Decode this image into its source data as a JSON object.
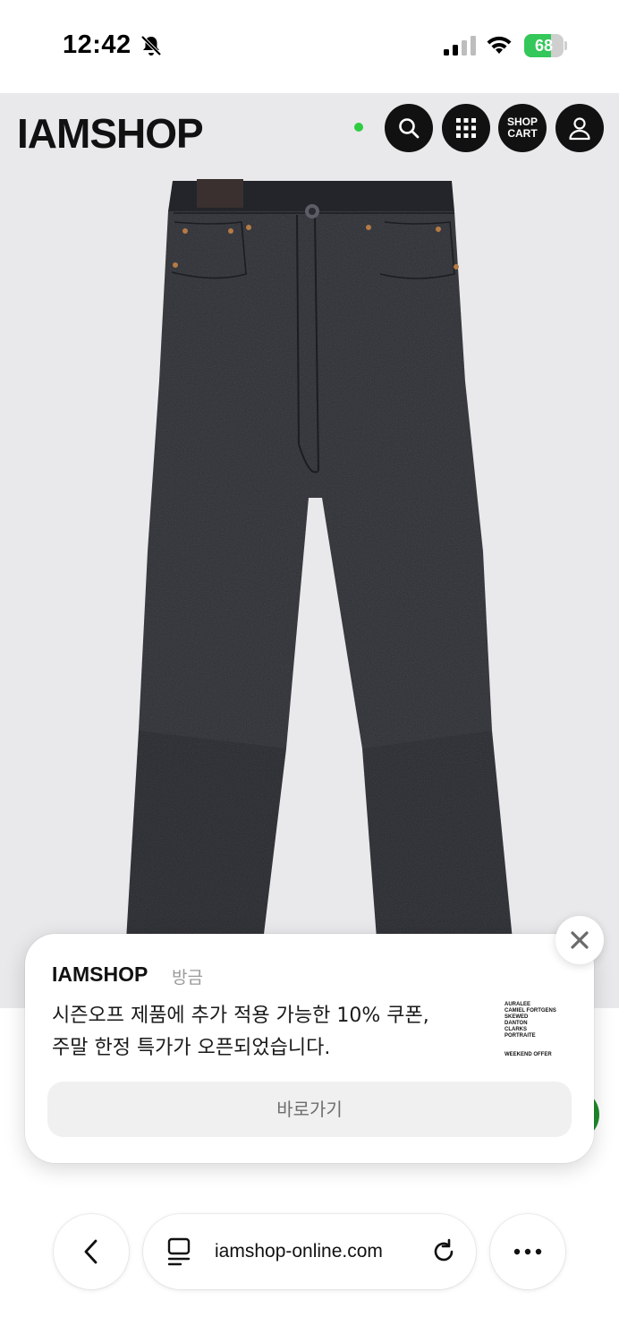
{
  "status_bar": {
    "time": "12:42",
    "battery_percent": "68",
    "battery_level": 0.68,
    "icons": [
      "bell-slash-icon",
      "cellular-signal-icon",
      "wifi-icon",
      "battery-charging-icon"
    ]
  },
  "site_header": {
    "logo": "IAMSHOP",
    "cart_label_line1": "SHOP",
    "cart_label_line2": "CART",
    "icons": [
      "search-icon",
      "grid-menu-icon",
      "user-icon"
    ]
  },
  "notification": {
    "app_name": "IAMSHOP",
    "time": "방금",
    "body_line1": "시즌오프 제품에 추가 적용 가능한 10% 쿠폰,",
    "body_line2": "주말 한정 특가가 오픈되었습니다.",
    "action_label": "바로가기",
    "thumbnail": {
      "brands": [
        "AURALEE",
        "CAMIEL FORTGENS",
        "SKEWED",
        "DANTON",
        "CLARKS",
        "PORTRAITE"
      ],
      "offer": "WEEKEND OFFER"
    }
  },
  "browser": {
    "url": "iamshop-online.com",
    "icons": [
      "chevron-left-icon",
      "page-menu-icon",
      "reload-icon",
      "more-icon"
    ]
  },
  "colors": {
    "online_dot": "#2ecc40",
    "battery_green": "#34c759",
    "header_button_bg": "#111111",
    "page_bg": "#e9e9eb"
  }
}
